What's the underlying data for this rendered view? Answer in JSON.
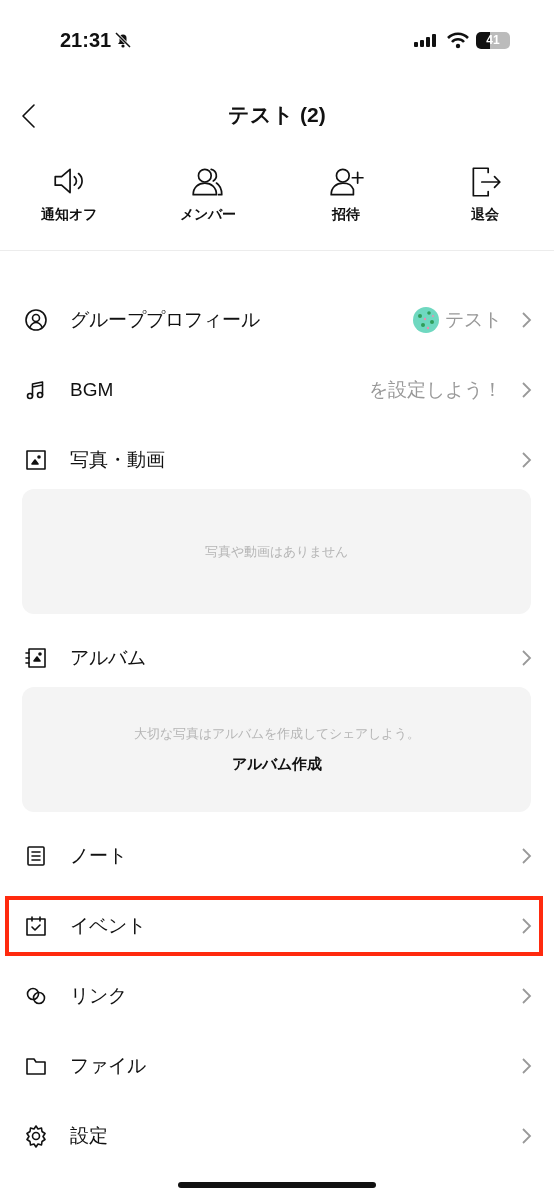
{
  "status_bar": {
    "time": "21:31",
    "battery": "41"
  },
  "header": {
    "title": "テスト (2)"
  },
  "actions": [
    {
      "label": "通知オフ"
    },
    {
      "label": "メンバー"
    },
    {
      "label": "招待"
    },
    {
      "label": "退会"
    }
  ],
  "items": [
    {
      "kind": "row",
      "label": "グループプロフィール",
      "value": "テスト",
      "avatar": true,
      "highlighted": false
    },
    {
      "kind": "row",
      "label": "BGM",
      "value": "を設定しよう！",
      "highlighted": false
    },
    {
      "kind": "row",
      "label": "写真・動画",
      "highlighted": false
    },
    {
      "kind": "panel",
      "message": "写真や動画はありません"
    },
    {
      "kind": "row",
      "label": "アルバム",
      "highlighted": false
    },
    {
      "kind": "panel",
      "message": "大切な写真はアルバムを作成してシェアしよう。",
      "action": "アルバム作成"
    },
    {
      "kind": "row",
      "label": "ノート",
      "highlighted": false
    },
    {
      "kind": "row",
      "label": "イベント",
      "highlighted": true
    },
    {
      "kind": "row",
      "label": "リンク",
      "highlighted": false
    },
    {
      "kind": "row",
      "label": "ファイル",
      "highlighted": false
    },
    {
      "kind": "row",
      "label": "設定",
      "highlighted": false
    }
  ]
}
